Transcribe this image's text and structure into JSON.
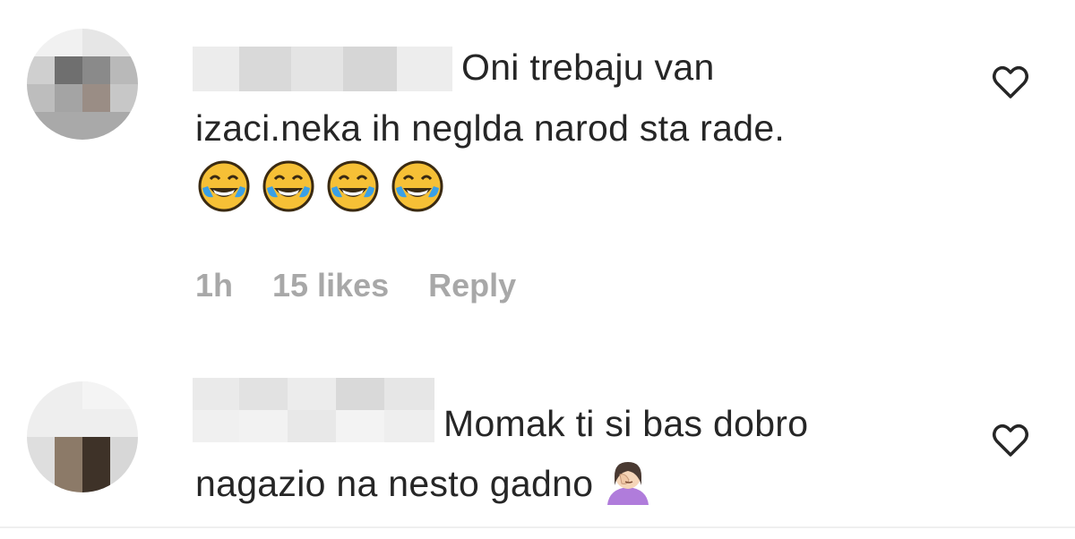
{
  "comments": [
    {
      "text_line1": "Oni trebaju van",
      "text_line2": "izaci.neka ih neglda narod sta rade.",
      "emoji_count": 4,
      "time": "1h",
      "likes": "15 likes",
      "reply_label": "Reply"
    },
    {
      "text_line1": "Momak ti si bas dobro",
      "text_line2": "nagazio na nesto gadno"
    }
  ],
  "icons": {
    "like": "heart-outline-icon",
    "emoji_1": "face-with-tears-of-joy",
    "emoji_2": "person-facepalming"
  },
  "colors": {
    "text": "#262626",
    "meta": "#a8a8a8",
    "background": "#ffffff"
  }
}
